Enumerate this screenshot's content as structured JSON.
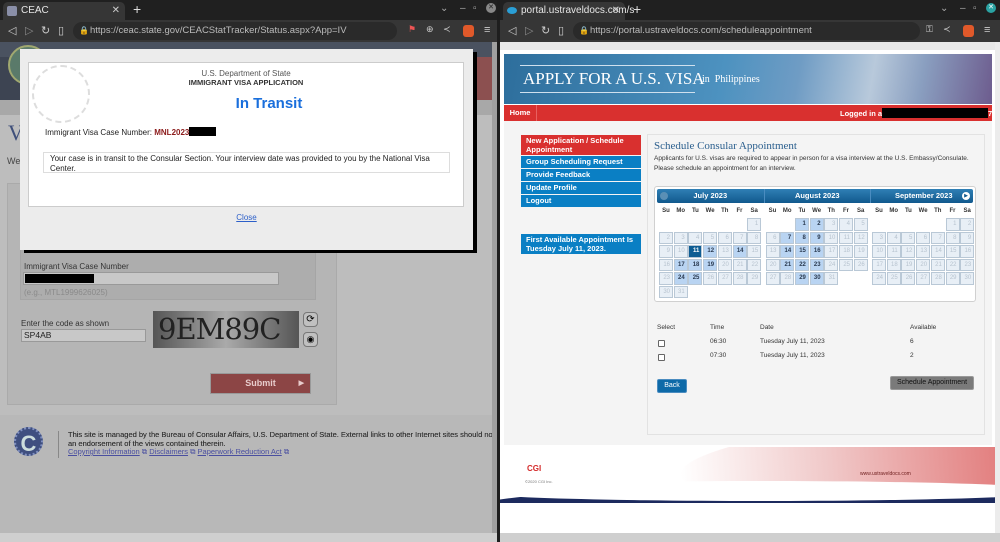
{
  "left_window": {
    "tab_title": "CEAC",
    "url": "https://ceac.state.gov/CEACStatTracker/Status.aspx?App=IV",
    "page": {
      "heading_partial": "V",
      "intro_partial": "We",
      "case_number_label": "Immigrant Visa Case Number",
      "case_number_hint": "(e.g., MTL1999626025)",
      "captcha_label": "Enter the code as shown",
      "captcha_value": "SP4AB",
      "captcha_image_text": "9EM89C",
      "submit_label": "Submit",
      "footer": {
        "text": "This site is managed by the Bureau of Consular Affairs, U.S. Department of State. External links to other Internet sites should not be construed as an endorsement of the views contained therein.",
        "text_line1": "This site is managed by the Bureau of Consular Affairs, U.S. Department of State. External links to other Internet sites should not be",
        "text_line2": "an endorsement of the views contained therein.",
        "links": [
          "Copyright Information",
          "Disclaimers",
          "Paperwork Reduction Act"
        ]
      }
    },
    "modal": {
      "dept": "U.S. Department of State",
      "app_type": "IMMIGRANT VISA APPLICATION",
      "status": "In Transit",
      "case_label": "Immigrant Visa Case Number:",
      "case_prefix": "MNL2023",
      "message": "Your case is in transit to the Consular Section. Your interview date was provided to you by the National Visa Center.",
      "close": "Close",
      "status_color": "#1a6fdc"
    }
  },
  "right_window": {
    "tab_title": "portal.ustraveldocs.com/s",
    "url": "https://portal.ustraveldocs.com/scheduleappointment",
    "banner": {
      "title": "APPLY FOR A U.S. VISA",
      "country": "in  Philippines"
    },
    "nav": {
      "home": "Home",
      "logged_in": "Logged in as",
      "suffix": "7)"
    },
    "sidebar": {
      "items": [
        "New Application / Schedule Appointment",
        "Group Scheduling Request",
        "Provide Feedback",
        "Update Profile",
        "Logout"
      ],
      "first_available": "First Available Appointment Is Tuesday July 11, 2023."
    },
    "main": {
      "title": "Schedule Consular Appointment",
      "description": "Applicants for U.S. visas are required to appear in person for a visa interview at the U.S. Embassy/Consulate. Please schedule an appointment for an interview.",
      "calendar": {
        "weekdays": [
          "Su",
          "Mo",
          "Tu",
          "We",
          "Th",
          "Fr",
          "Sa"
        ],
        "selected": {
          "month": "July 2023",
          "day": 11
        },
        "months": [
          {
            "label": "July 2023",
            "year": 2023,
            "month": 7,
            "available": [
              11,
              12,
              14,
              17,
              18,
              19,
              24,
              25
            ]
          },
          {
            "label": "August 2023",
            "year": 2023,
            "month": 8,
            "available": [
              1,
              2,
              7,
              8,
              9,
              14,
              15,
              16,
              21,
              22,
              23,
              29,
              30
            ]
          },
          {
            "label": "September 2023",
            "year": 2023,
            "month": 9,
            "available": []
          }
        ]
      },
      "table": {
        "headers": [
          "Select",
          "Time",
          "Date",
          "Available"
        ],
        "rows": [
          {
            "time": "06:30",
            "date": "Tuesday July 11, 2023",
            "available": "6",
            "checked": false
          },
          {
            "time": "07:30",
            "date": "Tuesday July 11, 2023",
            "available": "2",
            "checked": false
          }
        ]
      },
      "back": "Back",
      "schedule": "Schedule Appointment"
    },
    "footer": {
      "brand": "CGI",
      "copyright": "©2020 CGI Inc.",
      "site": "www.ustraveldocs.com"
    }
  },
  "colors": {
    "nav_red": "#d9302f",
    "menu_blue": "#0a7fc4",
    "selected_day": "#0e5d93",
    "available_day": "#b9d4f2"
  }
}
